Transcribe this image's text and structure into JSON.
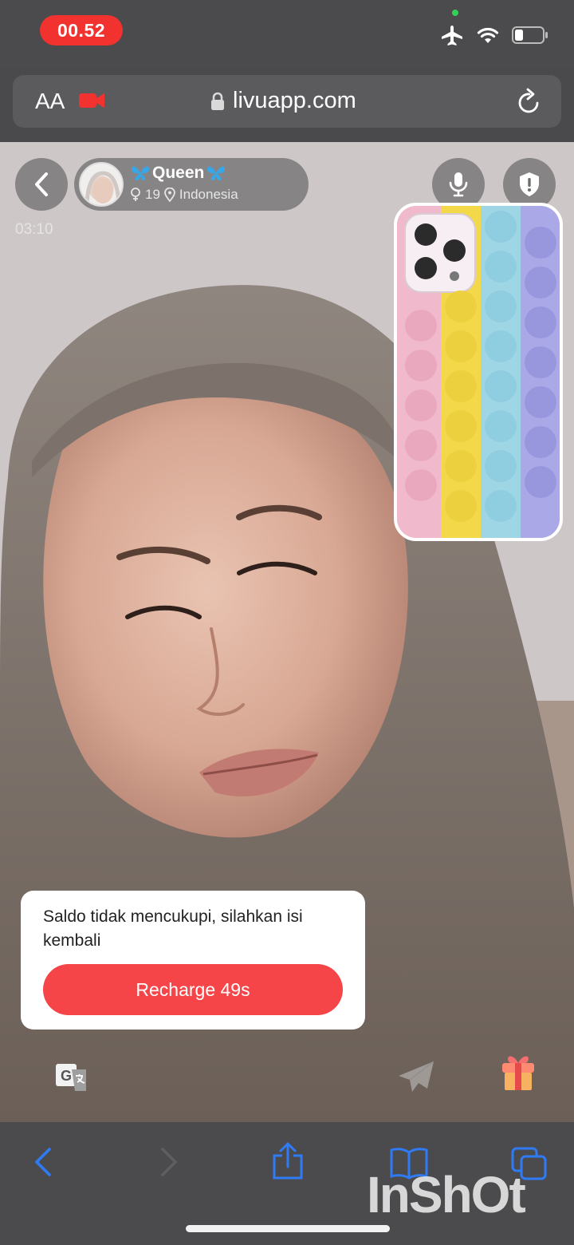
{
  "status_bar": {
    "time": "00.52",
    "icons": [
      "airplane-icon",
      "wifi-icon",
      "battery-icon"
    ],
    "colors": {
      "time_pill": "#f2322f",
      "privacy_dot": "#34d158"
    }
  },
  "browser": {
    "text_size_label": "AA",
    "url": "livuapp.com",
    "icons": [
      "screen-record-icon",
      "lock-icon",
      "reload-icon"
    ]
  },
  "call": {
    "profile": {
      "name": "Queen",
      "age": "19",
      "country": "Indonesia"
    },
    "timer": "03:10",
    "top_controls": [
      "mic-icon",
      "shield-icon"
    ],
    "bottom_controls": [
      "translate-icon",
      "send-icon",
      "gift-icon"
    ]
  },
  "recharge": {
    "message": "Saldo tidak mencukupi, silahkan isi kembali",
    "button_label": "Recharge 49s",
    "button_color": "#f64548"
  },
  "toolbar": {
    "icons": [
      "back-icon",
      "forward-icon",
      "share-icon",
      "bookmarks-icon",
      "tabs-icon"
    ],
    "accent": "#2f7bf5"
  },
  "watermark": "InShOt"
}
